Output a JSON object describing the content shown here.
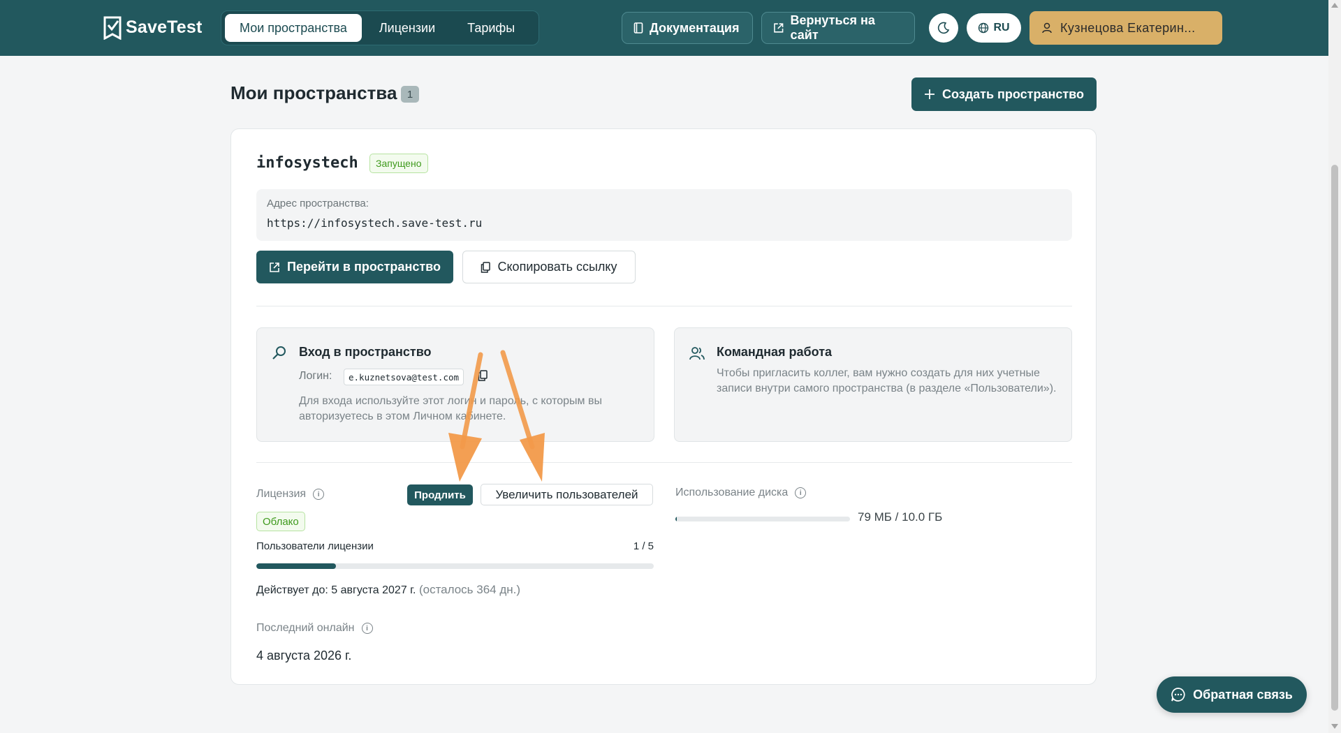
{
  "app": {
    "logo_text": "SaveTest"
  },
  "nav": {
    "tabs": [
      {
        "label": "Мои пространства",
        "active": true
      },
      {
        "label": "Лицензии",
        "active": false
      },
      {
        "label": "Тарифы",
        "active": false
      }
    ]
  },
  "header": {
    "docs_label": "Документация",
    "back_label": "Вернуться на сайт",
    "lang_label": "RU",
    "user_label": "Кузнецова  Екатерин..."
  },
  "page": {
    "title": "Мои пространства",
    "count": "1",
    "create_label": "Создать пространство"
  },
  "space": {
    "name": "infosystech",
    "status": "Запущено",
    "address_label": "Адрес пространства:",
    "address_value": "https://infosystech.save-test.ru",
    "go_label": "Перейти в пространство",
    "copy_label": "Скопировать ссылку"
  },
  "login_box": {
    "title": "Вход в пространство",
    "login_label": "Логин:",
    "login_value": "e.kuznetsova@test.com",
    "hint": "Для входа используйте этот логин и пароль, с которым вы авторизуетесь в этом Личном кабинете."
  },
  "team_box": {
    "title": "Командная работа",
    "text": "Чтобы пригласить коллег, вам нужно создать для них учетные записи внутри самого пространства (в разделе «Пользователи»)."
  },
  "license": {
    "label": "Лицензия",
    "renew_label": "Продлить",
    "more_users_label": "Увеличить пользователей",
    "type": "Облако",
    "users_label": "Пользователи лицензии",
    "users_count": "1 / 5",
    "users_fill_fraction": 0.2,
    "valid_label": "Действует до: 5 августа 2027 г.",
    "remaining": "(осталось 364 дн.)"
  },
  "disk": {
    "label": "Использование диска",
    "value": "79 МБ / 10.0 ГБ",
    "fill_fraction": 0.008
  },
  "last_online": {
    "label": "Последний онлайн",
    "value": "4 августа 2026 г."
  },
  "feedback": {
    "label": "Обратная связь"
  },
  "colors": {
    "header_bg": "#22585e",
    "primary": "#22585e",
    "accent_user": "#d9b068",
    "success": "#3f9a1d",
    "annotation_arrow": "#f29a4a"
  },
  "icons": [
    "logo-icon",
    "book-icon",
    "external-link-icon",
    "moon-icon",
    "globe-icon",
    "user-icon",
    "plus-icon",
    "copy-icon",
    "search-key-icon",
    "team-icon",
    "info-icon",
    "chat-icon"
  ]
}
